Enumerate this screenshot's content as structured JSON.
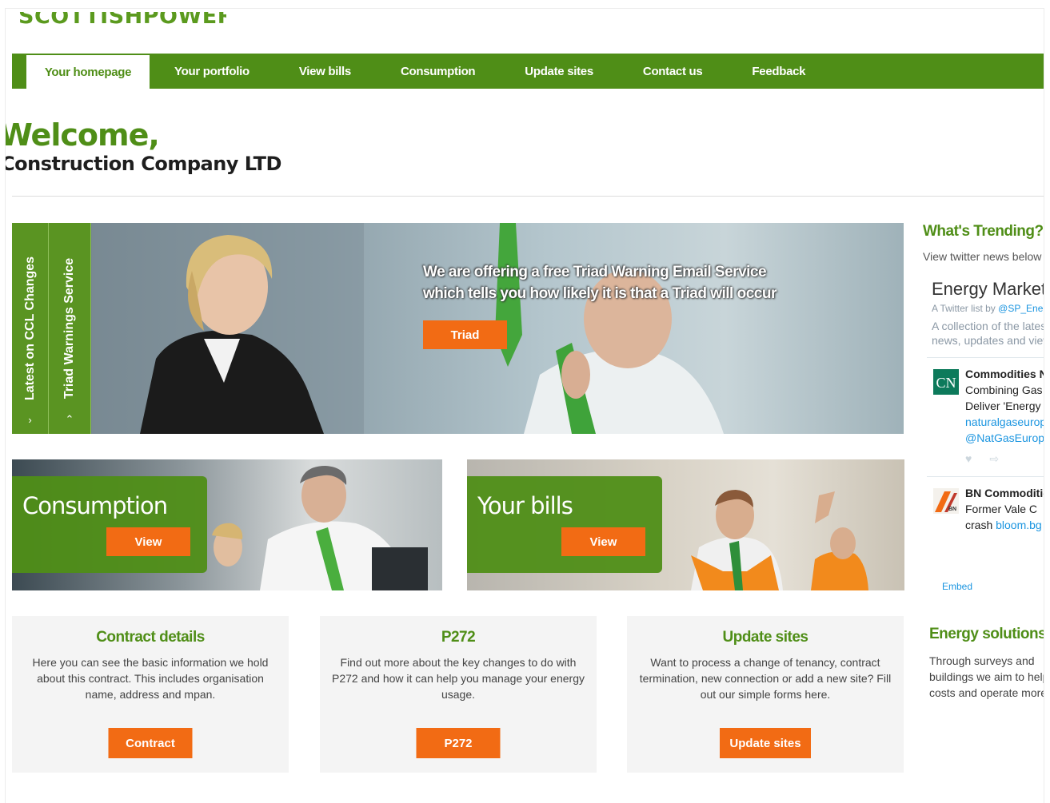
{
  "brand": {
    "name": "SCOTTISHPOWER"
  },
  "nav": {
    "items": [
      "Your homepage",
      "Your portfolio",
      "View bills",
      "Consumption",
      "Update sites",
      "Contact us",
      "Feedback"
    ]
  },
  "welcome": {
    "greeting": "Welcome,",
    "company": "Construction Company LTD"
  },
  "hero": {
    "tabs": [
      "Latest on CCL Changes",
      "Triad Warnings Service"
    ],
    "tab_icons": [
      "chevron-right-icon",
      "chevron-up-icon"
    ],
    "text_line1": "We are offering a free Triad Warning Email Service",
    "text_line2": "which tells you how likely it is that a Triad will occur",
    "button": "Triad"
  },
  "tiles": [
    {
      "title": "Consumption",
      "button": "View"
    },
    {
      "title": "Your bills",
      "button": "View"
    }
  ],
  "cards": [
    {
      "title": "Contract details",
      "text": "Here you can see the basic information we hold about this contract. This includes organisation name, address and mpan.",
      "button": "Contract"
    },
    {
      "title": "P272",
      "text": "Find out more about the key changes to do with P272 and how it can help you manage your energy usage.",
      "button": "P272"
    },
    {
      "title": "Update sites",
      "text": "Want to process a change of tenancy, contract termination, new connection or add a new site? Fill out our simple forms here.",
      "button": "Update sites"
    }
  ],
  "sidebar": {
    "trending_title": "What's Trending?",
    "trending_sub": "View twitter news below",
    "twitter": {
      "list_title": "Energy Markets",
      "list_by": "A Twitter list by",
      "list_handle": "@SP_Energy",
      "list_desc_1": "A collection of the latest",
      "list_desc_2": "news, updates and views",
      "tweets": [
        {
          "avatar": "CN",
          "author": "Commodities Now",
          "line1": "Combining Gas",
          "line2": "Deliver 'Energy",
          "link": "naturalgaseurope",
          "handle": "@NatGasEurope"
        },
        {
          "avatar": "BN",
          "author": "BN Commodities",
          "line1": "Former Vale C",
          "line2": "crash",
          "link": "bloom.bg"
        }
      ],
      "embed": "Embed"
    },
    "solutions_title": "Energy solutions",
    "solutions_1": "Through surveys and",
    "solutions_2": "buildings we aim to help",
    "solutions_3": "costs and operate more"
  },
  "colors": {
    "brand_green": "#4f8e17",
    "accent_orange": "#f26b14"
  }
}
